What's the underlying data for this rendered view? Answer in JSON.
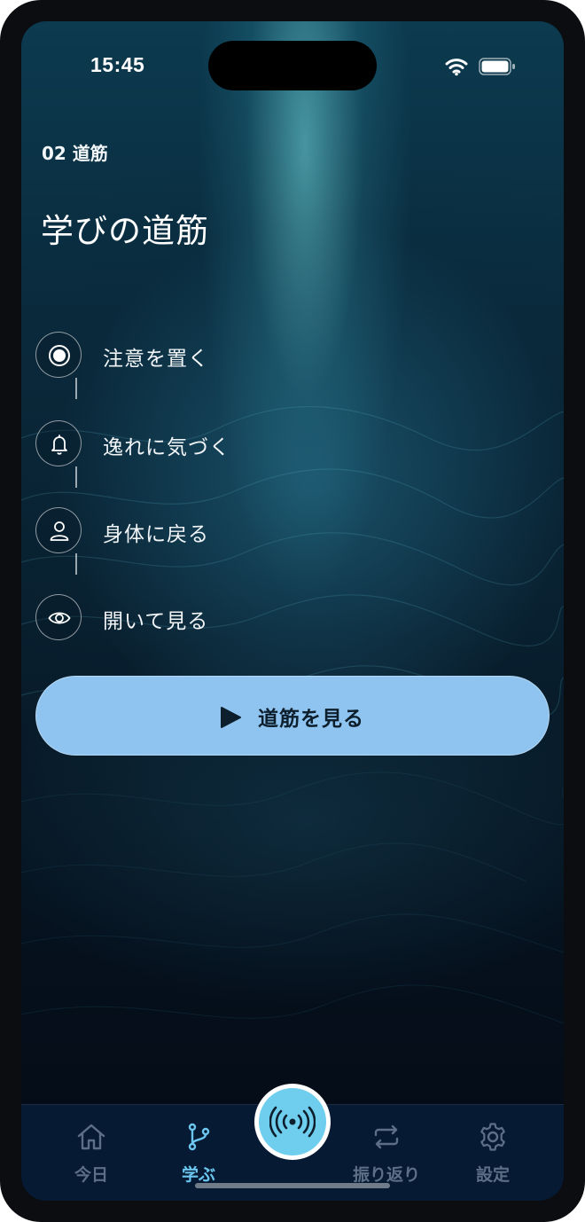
{
  "status_bar": {
    "time": "15:45",
    "icons": [
      "wifi-icon",
      "battery-icon"
    ]
  },
  "header": {
    "section_label": "02 道筋",
    "title": "学びの道筋"
  },
  "steps": [
    {
      "label": "注意を置く",
      "icon": "target-icon"
    },
    {
      "label": "逸れに気づく",
      "icon": "bell-icon"
    },
    {
      "label": "身体に戻る",
      "icon": "person-icon"
    },
    {
      "label": "開いて見る",
      "icon": "eye-icon"
    }
  ],
  "cta": {
    "label": "道筋を見る",
    "icon": "play-icon"
  },
  "tabbar": {
    "tabs": [
      {
        "label": "今日",
        "icon": "home-icon",
        "active": false
      },
      {
        "label": "学ぶ",
        "icon": "branch-icon",
        "active": true
      },
      {
        "label": "振り返り",
        "icon": "repeat-icon",
        "active": false
      },
      {
        "label": "設定",
        "icon": "gear-icon",
        "active": false
      }
    ],
    "center_icon": "broadcast-icon"
  },
  "colors": {
    "accent": "#6cc7f0",
    "cta_background": "#8ec4ef",
    "tabbar_background": "#071a33",
    "inactive_tab": "#5d6f87"
  }
}
